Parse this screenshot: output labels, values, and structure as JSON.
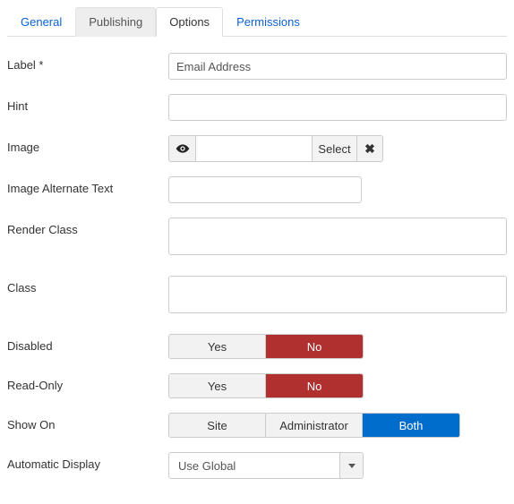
{
  "tabs": {
    "general": "General",
    "publishing": "Publishing",
    "options": "Options",
    "permissions": "Permissions"
  },
  "labels": {
    "label": "Label *",
    "hint": "Hint",
    "image": "Image",
    "image_alt": "Image Alternate Text",
    "render_class": "Render Class",
    "class": "Class",
    "disabled": "Disabled",
    "readonly": "Read-Only",
    "show_on": "Show On",
    "auto_display": "Automatic Display"
  },
  "fields": {
    "label_value": "Email Address",
    "hint_value": "",
    "image_path": "",
    "image_select": "Select",
    "image_alt_value": "",
    "render_class_value": "",
    "class_value": ""
  },
  "toggle": {
    "yes": "Yes",
    "no": "No"
  },
  "show_on": {
    "site": "Site",
    "admin": "Administrator",
    "both": "Both"
  },
  "auto_display": {
    "selected": "Use Global"
  },
  "icons": {
    "eye": "eye-icon",
    "clear": "clear-icon",
    "caret": "caret-icon"
  }
}
